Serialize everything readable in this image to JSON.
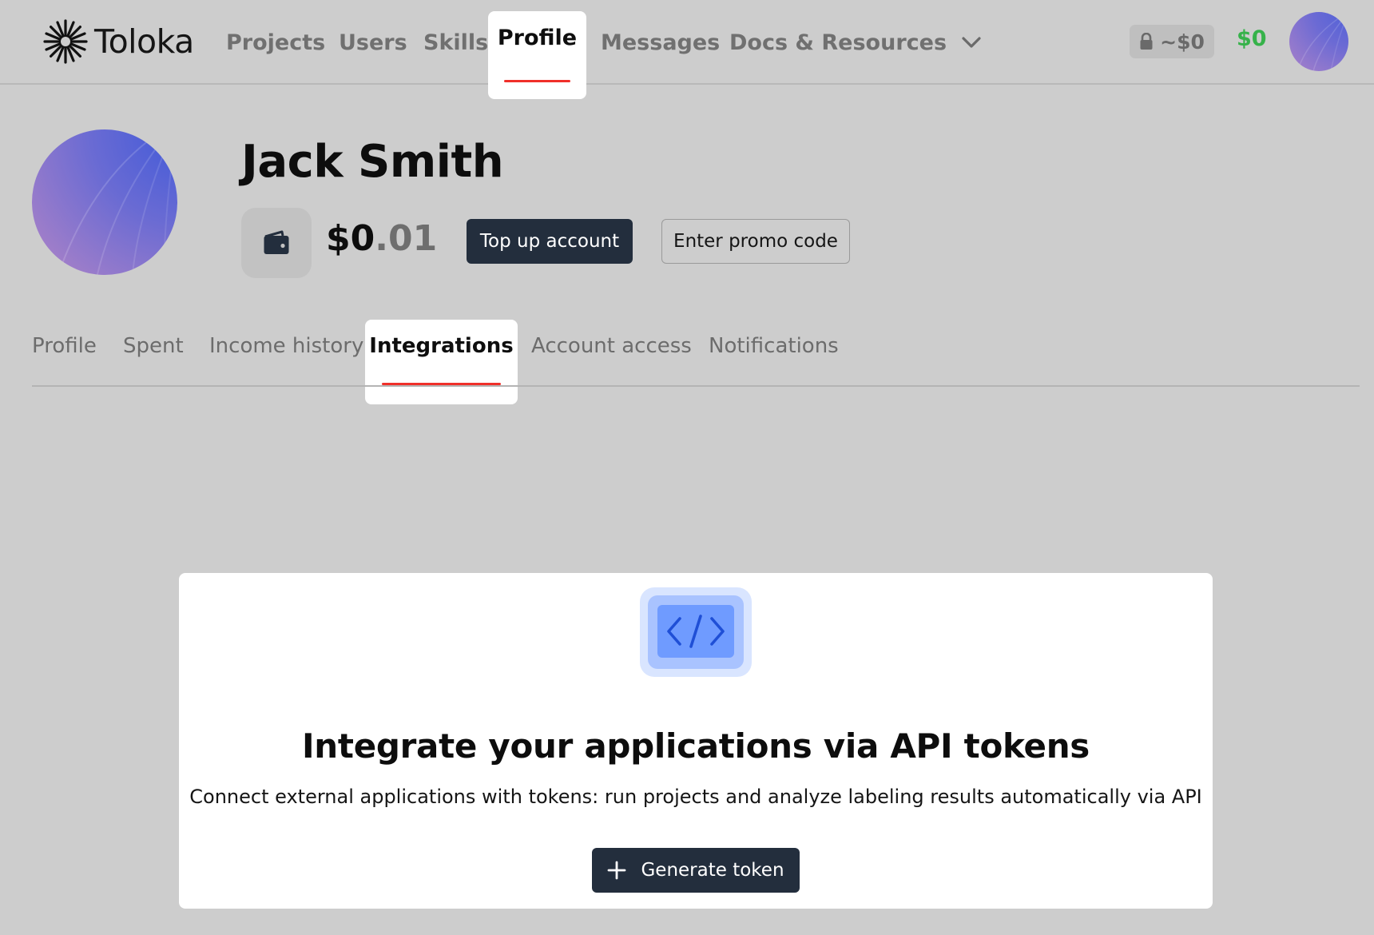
{
  "header": {
    "brand": "Toloka",
    "nav": {
      "projects": "Projects",
      "users": "Users",
      "skills": "Skills",
      "profile": "Profile",
      "messages": "Messages",
      "docs": "Docs & Resources"
    },
    "locked_balance": "~$0",
    "balance": "$0",
    "icons": [
      "toloka-logo-icon",
      "chevron-down-icon",
      "lock-icon",
      "avatar"
    ]
  },
  "profile": {
    "name": "Jack Smith",
    "balance_whole": "$0",
    "balance_cents": ".01",
    "top_up_label": "Top up account",
    "promo_label": "Enter promo code",
    "icons": [
      "wallet-icon"
    ]
  },
  "tabs": {
    "profile": "Profile",
    "spent": "Spent",
    "income_history": "Income history",
    "integrations": "Integrations",
    "account_access": "Account access",
    "notifications": "Notifications",
    "active": "integrations"
  },
  "integrations": {
    "title": "Integrate your applications via API tokens",
    "description": "Connect external applications with tokens: run projects and analyze labeling results automatically via API",
    "generate_label": "Generate token",
    "icons": [
      "code-icon",
      "plus-icon"
    ]
  },
  "colors": {
    "background": "#cdcdcd",
    "accent_underline": "#f0302a",
    "dark_button": "#232e3d",
    "balance_green": "#36b24a",
    "illustration_blue": "#6f9bff"
  }
}
